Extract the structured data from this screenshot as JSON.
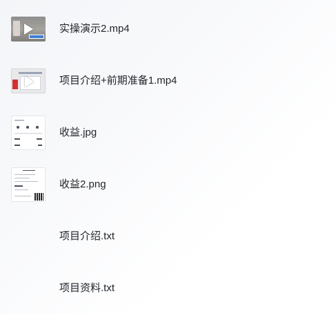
{
  "files": [
    {
      "name": "实操演示2.mp4",
      "kind": "video",
      "icon": "video-thumbnail-icon"
    },
    {
      "name": "项目介绍+前期准备1.mp4",
      "kind": "video",
      "icon": "video-thumbnail-icon"
    },
    {
      "name": "收益.jpg",
      "kind": "image",
      "icon": "image-thumbnail-icon"
    },
    {
      "name": "收益2.png",
      "kind": "image",
      "icon": "image-thumbnail-icon"
    },
    {
      "name": "项目介绍.txt",
      "kind": "text",
      "icon": ""
    },
    {
      "name": "项目资料.txt",
      "kind": "text",
      "icon": ""
    }
  ],
  "colors": {
    "text": "#1f2329",
    "accent_blue": "#3b7dd8",
    "accent_red": "#d3312f"
  }
}
